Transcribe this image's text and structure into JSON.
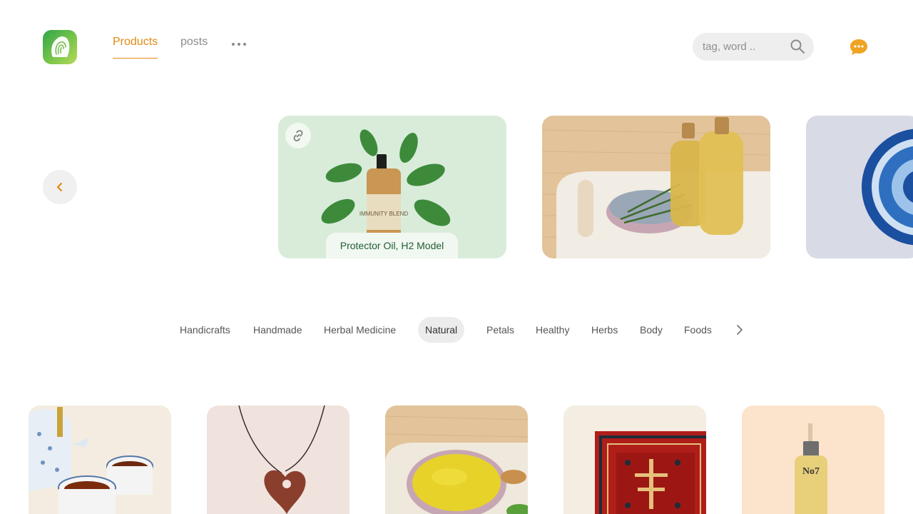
{
  "header": {
    "tabs": [
      {
        "label": "Products",
        "active": true
      },
      {
        "label": "posts",
        "active": false
      }
    ],
    "search_placeholder": "tag, word ..",
    "accent_color": "#e08a12"
  },
  "carousel": {
    "cards": [
      {
        "label": "Protector Oil, H2 Model",
        "bottle_text": "IMMUNITY BLEND",
        "background": "#d9ecda"
      },
      {
        "background": "#e6c9a1"
      },
      {
        "background": "#d8dae6"
      }
    ]
  },
  "tags": {
    "items": [
      "Handicrafts",
      "Handmade",
      "Herbal Medicine",
      "Natural",
      "Petals",
      "Healthy",
      "Herbs",
      "Body",
      "Foods"
    ],
    "selected": "Natural"
  },
  "products": [
    {
      "image": "tea-set"
    },
    {
      "image": "heart-necklace"
    },
    {
      "image": "oil-bowl"
    },
    {
      "image": "persian-rug"
    },
    {
      "image": "serum-bottle",
      "bottle_text": "No7"
    }
  ]
}
